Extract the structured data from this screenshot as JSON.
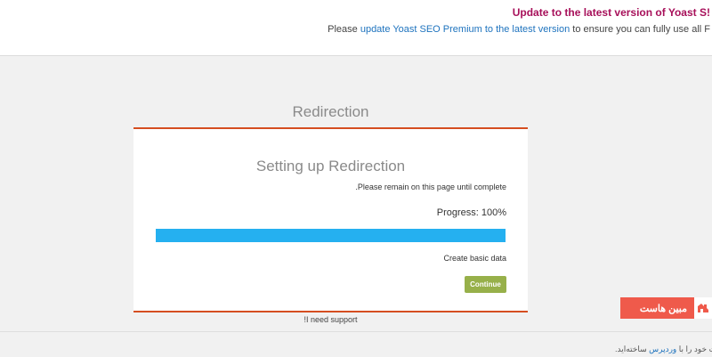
{
  "notice": {
    "title": "!Update to the latest version of Yoast S",
    "text_before": "Please ",
    "link": "update Yoast SEO Premium to the latest version",
    "text_after": " to ensure you can fully use all F"
  },
  "main": {
    "title": "Redirection",
    "wizard": {
      "heading": "Setting up Redirection",
      "remain_text": "Please remain on this page until complete.",
      "progress_label": "Progress: 100%",
      "progress_value": 100,
      "step_text": "Create basic data",
      "continue_label": "Continue"
    },
    "support_link": "I need support!"
  },
  "footer": {
    "before": "یت خود را با ",
    "link": "وردپرس",
    "after": " ساخته‌اید."
  },
  "badge": {
    "text": "مبین هاست"
  },
  "colors": {
    "accent_border": "#d54e21",
    "progress_fill": "#25b0f0",
    "continue_bg": "#97b04a",
    "notice_title": "#a7105a",
    "link": "#1e73be",
    "badge_bg": "#ef5a4b"
  }
}
